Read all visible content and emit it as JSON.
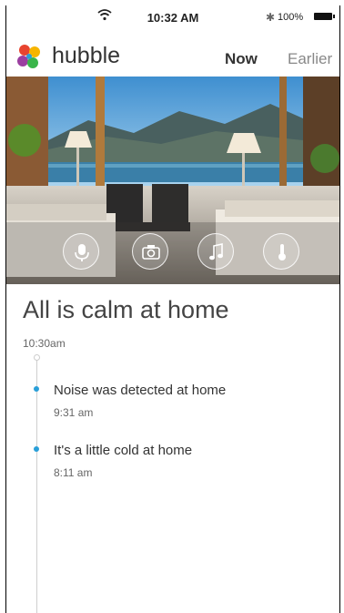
{
  "status_bar": {
    "time": "10:32 AM",
    "battery": "100%"
  },
  "app": {
    "name": "hubble",
    "tabs": [
      {
        "label": "Now",
        "active": true
      },
      {
        "label": "Earlier",
        "active": false
      }
    ]
  },
  "hero": {
    "actions": [
      {
        "icon": "microphone-icon"
      },
      {
        "icon": "camera-icon"
      },
      {
        "icon": "music-icon"
      },
      {
        "icon": "thermometer-icon"
      }
    ]
  },
  "summary": {
    "title": "All is calm at home",
    "time": "10:30am"
  },
  "events": [
    {
      "title": "Noise was detected at home",
      "time": "9:31 am"
    },
    {
      "title": "It's a little cold at home",
      "time": "8:11 am"
    }
  ],
  "colors": {
    "accent": "#2a9fd8",
    "logo": [
      "#e8442f",
      "#f7b500",
      "#3ab54a",
      "#9b3fa0",
      "#2a9fd8"
    ]
  }
}
